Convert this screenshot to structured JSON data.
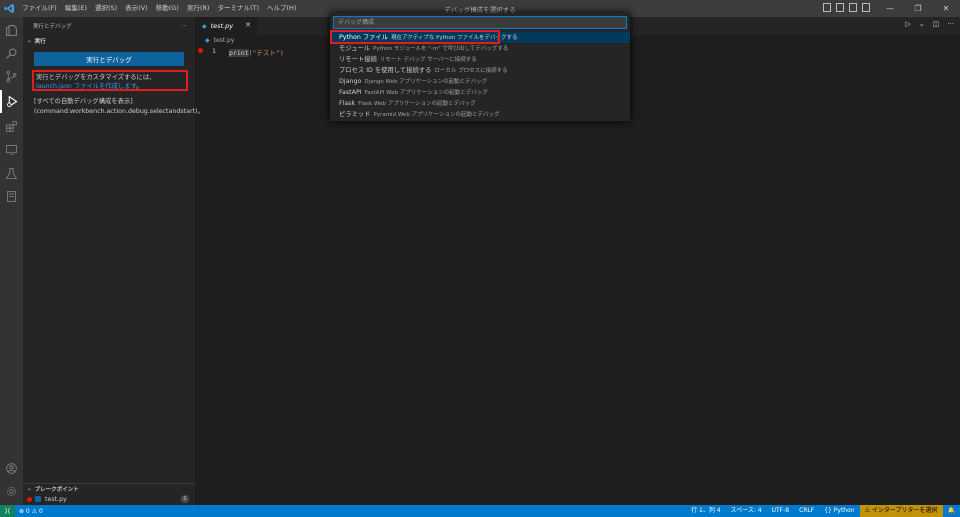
{
  "titlebar": {
    "menu": [
      "ファイル(F)",
      "編集(E)",
      "選択(S)",
      "表示(V)",
      "移動(G)",
      "実行(R)",
      "ターミナル(T)",
      "ヘルプ(H)"
    ],
    "title": "デバッグ構成を選択する"
  },
  "sidebar": {
    "header": "実行とデバッグ",
    "more": "···",
    "section": "実行",
    "run_button": "実行とデバッグ",
    "hint_pre": "実行とデバッグをカスタマイズするには、",
    "hint_link": "launch.json ファイルを作成します",
    "hint_post": "。",
    "show_all": "[すべての自動デバッグ構成を表示](command:workbench.action.debug.selectandstart)。",
    "breakpoints_header": "ブレークポイント",
    "breakpoint_file": "test.py",
    "breakpoint_count": "1"
  },
  "editor": {
    "tab_label": "test.py",
    "breadcrumb": "test.py",
    "line_number": "1",
    "code_fn": "print",
    "code_str": "(\"テスト\")"
  },
  "quickpick": {
    "placeholder": "デバッグ構成",
    "items": [
      {
        "label": "Python ファイル",
        "desc": "現在アクティブな Python ファイルをデバッグする"
      },
      {
        "label": "モジュール",
        "desc": "Python モジュールを \"-m\" で呼び出してデバッグする"
      },
      {
        "label": "リモート接続",
        "desc": "リモート デバッグ サーバーに接続する"
      },
      {
        "label": "プロセス ID を使用して接続する",
        "desc": "ローカル プロセスに接続する"
      },
      {
        "label": "Django",
        "desc": "Django Web アプリケーションの起動とデバッグ"
      },
      {
        "label": "FastAPI",
        "desc": "FastAPI Web アプリケーションの起動とデバッグ"
      },
      {
        "label": "Flask",
        "desc": "Flask Web アプリケーションの起動とデバッグ"
      },
      {
        "label": "ピラミッド",
        "desc": "Pyramid Web アプリケーションの起動とデバッグ"
      }
    ]
  },
  "statusbar": {
    "problems": "⊗ 0 ⚠ 0",
    "position": "行 1、列 4",
    "spaces": "スペース: 4",
    "encoding": "UTF-8",
    "eol": "CRLF",
    "language": "{} Python",
    "interpreter": "⚠ インタープリターを選択"
  },
  "colors": {
    "accent": "#007acc",
    "button": "#0e639c",
    "highlight": "#e01e1e"
  }
}
